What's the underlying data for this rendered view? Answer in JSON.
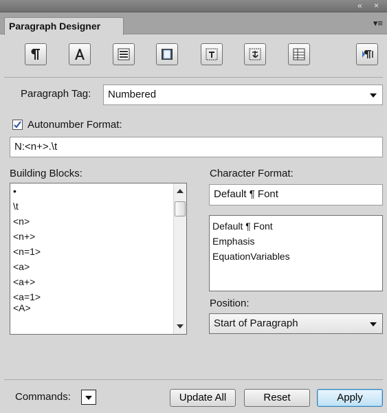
{
  "window": {
    "collapse_glyph": "«",
    "close_glyph": "×"
  },
  "tab": {
    "title": "Paragraph Designer",
    "menu_glyph": "▾≡"
  },
  "properties_buttons": [
    {
      "icon": "pilcrow-icon"
    },
    {
      "icon": "character-a-icon"
    },
    {
      "icon": "paragraph-lines-icon"
    },
    {
      "icon": "page-icon"
    },
    {
      "icon": "text-frame-icon"
    },
    {
      "icon": "asian-text-icon"
    },
    {
      "icon": "table-cell-icon"
    },
    {
      "icon": "text-direction-icon"
    }
  ],
  "paragraph_tag": {
    "label": "Paragraph Tag:",
    "value": "Numbered"
  },
  "autonumber": {
    "label": "Autonumber Format:",
    "checked": true,
    "value": "N:<n+>.\\t"
  },
  "building_blocks": {
    "label": "Building Blocks:",
    "items": [
      "•",
      "\\t",
      "<n>",
      "<n+>",
      "<n=1>",
      "<a>",
      "<a+>",
      "<a=1>",
      "<A>"
    ]
  },
  "character_format": {
    "label": "Character Format:",
    "value": "Default ¶ Font",
    "items": [
      "Default ¶ Font",
      "Emphasis",
      "EquationVariables"
    ]
  },
  "position": {
    "label": "Position:",
    "value": "Start of Paragraph"
  },
  "commands": {
    "label": "Commands:"
  },
  "buttons": {
    "update_all": "Update All",
    "reset": "Reset",
    "apply": "Apply"
  }
}
